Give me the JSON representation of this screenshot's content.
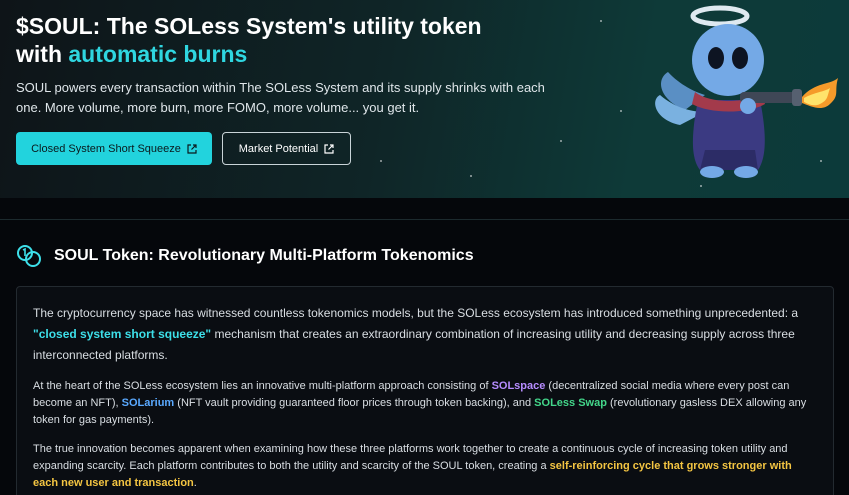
{
  "hero": {
    "title_main": "$SOUL: The SOLess System's utility token",
    "title_prefix": "with ",
    "title_accent": "automatic burns",
    "description": "SOUL powers every transaction within The SOLess System and its supply shrinks with each one. More volume, more burn, more FOMO, more volume... you get it.",
    "buttons": [
      {
        "label": "Closed System Short Squeeze",
        "icon": "external-link-icon"
      },
      {
        "label": "Market Potential",
        "icon": "external-link-icon"
      }
    ],
    "mascot": "angel-mascot-with-flamethrower"
  },
  "section": {
    "icon": "coins-icon",
    "title": "SOUL Token: Revolutionary Multi-Platform Tokenomics"
  },
  "article": {
    "p1_text1": "The cryptocurrency space has witnessed countless tokenomics models, but the SOLess ecosystem has introduced something unprecedented: a ",
    "p1_hl": "\"closed system short squeeze\"",
    "p1_text2": " mechanism that creates an extraordinary combination of increasing utility and decreasing supply across three interconnected platforms.",
    "p2_text1": "At the heart of the SOLess ecosystem lies an innovative multi-platform approach consisting of ",
    "p2_solspace": "SOLspace",
    "p2_text2": " (decentralized social media where every post can become an NFT), ",
    "p2_solarium": "SOLarium",
    "p2_text3": " (NFT vault providing guaranteed floor prices through token backing), and ",
    "p2_swap": "SOLess Swap",
    "p2_text4": " (revolutionary gasless DEX allowing any token for gas payments).",
    "p3_text1": "The true innovation becomes apparent when examining how these three platforms work together to create a continuous cycle of increasing token utility and expanding scarcity. Each platform contributes to both the utility and scarcity of the SOUL token, creating a ",
    "p3_hl": "self-reinforcing cycle that grows stronger with each new user and transaction",
    "p3_text2": "."
  },
  "colors": {
    "accent": "#2fd6e0",
    "button_primary": "#22d3dd",
    "highlight_purple": "#b68cff",
    "highlight_blue": "#5aa9ff",
    "highlight_green": "#43d68a",
    "highlight_yellow": "#f4c542"
  }
}
